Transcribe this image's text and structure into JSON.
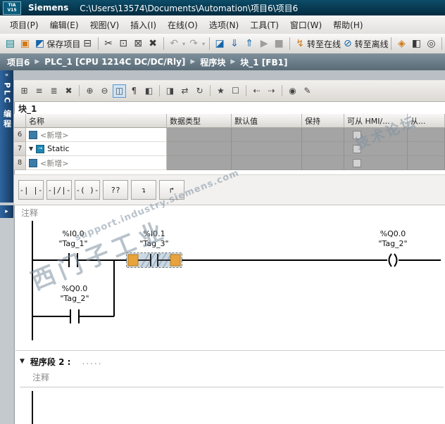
{
  "colors": {
    "titlebar": "#063a52",
    "breadcrumb_bar": "#64707b",
    "sidebar_tab": "#1c4a78",
    "selection_handle_orange": "#e8a33d",
    "watermark": "#8ca0b3",
    "toolbar_accent_blue": "#1565a8",
    "disabled_cell_gray": "#a4a4a4"
  },
  "window": {
    "logo_top": "TIA",
    "logo_bottom": "V15",
    "app_name": "Siemens",
    "document_path": "C:\\Users\\13574\\Documents\\Automation\\项目6\\项目6"
  },
  "menu": {
    "items": [
      "项目(P)",
      "编辑(E)",
      "视图(V)",
      "插入(I)",
      "在线(O)",
      "选项(N)",
      "工具(T)",
      "窗口(W)",
      "帮助(H)"
    ]
  },
  "toolbar": {
    "items": [
      {
        "name": "new-project-icon",
        "glyph": "▤",
        "cls": "c-teal"
      },
      {
        "name": "open-project-icon",
        "glyph": "▣",
        "cls": "c-orange"
      },
      {
        "name": "save-project-icon",
        "glyph": "◩",
        "cls": "c-blue"
      },
      {
        "name": "save-project-label",
        "glyph": "保存项目",
        "cls": "tlabel"
      },
      {
        "name": "print-icon",
        "glyph": "⊟",
        "cls": ""
      },
      {
        "name": "separator",
        "glyph": "",
        "cls": "sep"
      },
      {
        "name": "cut-icon",
        "glyph": "✂",
        "cls": ""
      },
      {
        "name": "copy-icon",
        "glyph": "⊡",
        "cls": ""
      },
      {
        "name": "paste-icon",
        "glyph": "⊠",
        "cls": ""
      },
      {
        "name": "delete-icon",
        "glyph": "✖",
        "cls": ""
      },
      {
        "name": "separator",
        "glyph": "",
        "cls": "sep"
      },
      {
        "name": "undo-icon",
        "glyph": "↶",
        "cls": "c-gray"
      },
      {
        "name": "undo-dropdown-icon",
        "glyph": "▾",
        "cls": "c-gray mini"
      },
      {
        "name": "redo-icon",
        "glyph": "↷",
        "cls": "c-gray"
      },
      {
        "name": "redo-dropdown-icon",
        "glyph": "▾",
        "cls": "c-gray mini"
      },
      {
        "name": "separator",
        "glyph": "",
        "cls": "sep"
      },
      {
        "name": "compile-icon",
        "glyph": "◪",
        "cls": "c-blue"
      },
      {
        "name": "download-to-device-icon",
        "glyph": "⇓",
        "cls": "c-blue"
      },
      {
        "name": "upload-from-device-icon",
        "glyph": "⇑",
        "cls": "c-blue"
      },
      {
        "name": "start-cpu-icon",
        "glyph": "▶",
        "cls": "c-gray"
      },
      {
        "name": "stop-cpu-icon",
        "glyph": "■",
        "cls": "c-gray"
      },
      {
        "name": "separator",
        "glyph": "",
        "cls": "sep"
      },
      {
        "name": "go-online-icon",
        "glyph": "↯",
        "cls": "c-orange"
      },
      {
        "name": "go-online-label",
        "glyph": "转至在线",
        "cls": "tlabel"
      },
      {
        "name": "go-offline-icon",
        "glyph": "⊘",
        "cls": "c-blue"
      },
      {
        "name": "go-offline-label",
        "glyph": "转至离线",
        "cls": "tlabel"
      },
      {
        "name": "separator",
        "glyph": "",
        "cls": "sep"
      },
      {
        "name": "diagnostics-icon",
        "glyph": "◈",
        "cls": "c-orange"
      },
      {
        "name": "window-split-icon",
        "glyph": "◧",
        "cls": ""
      },
      {
        "name": "search-project-icon",
        "glyph": "◎",
        "cls": ""
      },
      {
        "name": "separator",
        "glyph": "",
        "cls": "sep"
      }
    ]
  },
  "breadcrumb": {
    "separator": "▶",
    "items": [
      "项目6",
      "PLC_1 [CPU 1214C DC/DC/Rly]",
      "程序块",
      "块_1 [FB1]"
    ]
  },
  "sidebar": {
    "collapse_icon": "«",
    "tab_label": "PLC 编程",
    "secondary_tab_icon": "▸"
  },
  "block_editor": {
    "block_title": "块_1",
    "toolbar_items": [
      {
        "name": "insert-network-icon",
        "glyph": "⊞",
        "cls": ""
      },
      {
        "name": "insert-row-before-icon",
        "glyph": "≡",
        "cls": ""
      },
      {
        "name": "insert-row-after-icon",
        "glyph": "≣",
        "cls": ""
      },
      {
        "name": "delete-row-icon",
        "glyph": "✖",
        "cls": "c-gray"
      },
      {
        "name": "separator",
        "glyph": "",
        "cls": "sep"
      },
      {
        "name": "expand-all-networks-icon",
        "glyph": "⊕",
        "cls": ""
      },
      {
        "name": "collapse-all-networks-icon",
        "glyph": "⊖",
        "cls": ""
      },
      {
        "name": "absolute-symbolic-toggle-icon",
        "glyph": "◫",
        "cls": "active"
      },
      {
        "name": "network-comments-toggle-icon",
        "glyph": "¶",
        "cls": ""
      },
      {
        "name": "free-form-comment-icon",
        "glyph": "◧",
        "cls": ""
      },
      {
        "name": "separator",
        "glyph": "",
        "cls": "sep"
      },
      {
        "name": "snapshot-icon",
        "glyph": "◨",
        "cls": ""
      },
      {
        "name": "retain-values-icon",
        "glyph": "⇄",
        "cls": ""
      },
      {
        "name": "update-block-calls-icon",
        "glyph": "↻",
        "cls": ""
      },
      {
        "name": "separator",
        "glyph": "",
        "cls": "sep"
      },
      {
        "name": "favorites-star-icon",
        "glyph": "★",
        "cls": "c-gold"
      },
      {
        "name": "insert-empty-box-icon",
        "glyph": "☐",
        "cls": ""
      },
      {
        "name": "separator",
        "glyph": "",
        "cls": "sep"
      },
      {
        "name": "previous-error-icon",
        "glyph": "⇠",
        "cls": ""
      },
      {
        "name": "next-error-icon",
        "glyph": "⇢",
        "cls": ""
      },
      {
        "name": "separator",
        "glyph": "",
        "cls": "sep"
      },
      {
        "name": "monitoring-on-off-icon",
        "glyph": "◉",
        "cls": ""
      },
      {
        "name": "modify-operand-icon",
        "glyph": "✎",
        "cls": ""
      }
    ],
    "interface_table": {
      "columns": [
        "名称",
        "数据类型",
        "默认值",
        "保持",
        "可从 HMI/...",
        "从..."
      ],
      "rows": [
        {
          "num": "6",
          "name": "<新增>"
        },
        {
          "num": "7",
          "name": "Static",
          "caret": "▼",
          "icon_glyph": "→"
        },
        {
          "num": "8",
          "name": "<新增>"
        }
      ]
    },
    "palette_items": [
      {
        "name": "no-contact-button",
        "glyph": "-| |-",
        "cls": ""
      },
      {
        "name": "nc-contact-button",
        "glyph": "-|/|-",
        "cls": ""
      },
      {
        "name": "coil-button",
        "glyph": "-( )-",
        "cls": ""
      },
      {
        "name": "empty-box-button",
        "glyph": "??",
        "cls": ""
      },
      {
        "name": "open-branch-button",
        "glyph": "↴",
        "cls": ""
      },
      {
        "name": "close-branch-button",
        "glyph": "↱",
        "cls": ""
      }
    ],
    "network1": {
      "comment": "注释",
      "contact1": {
        "address": "%I0.0",
        "tag": "\"Tag_1\""
      },
      "contact2": {
        "address": "%I0.1",
        "tag": "\"Tag_3\""
      },
      "branch_contact": {
        "address": "%Q0.0",
        "tag": "\"Tag_2\""
      },
      "coil": {
        "address": "%Q0.0",
        "tag": "\"Tag_2\""
      }
    },
    "network2": {
      "collapse_icon": "▼",
      "title": "程序段 2 :",
      "dots": ".....",
      "comment": "注释"
    }
  },
  "watermark": {
    "brand": "西门子工业",
    "url": "support.industry.siemens.com",
    "forum": "技术论坛"
  }
}
